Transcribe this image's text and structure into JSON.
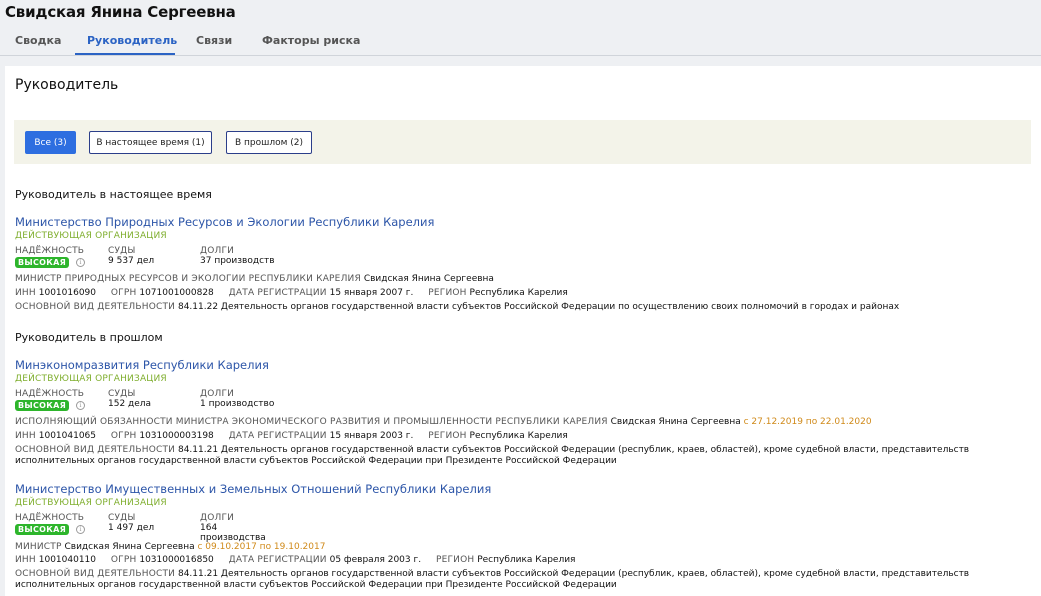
{
  "header": {
    "title": "Свидская Янина Сергеевна"
  },
  "tabs": [
    {
      "label": "Сводка"
    },
    {
      "label": "Руководитель"
    },
    {
      "label": "Связи"
    },
    {
      "label": "Факторы риска"
    }
  ],
  "section": {
    "title": "Руководитель"
  },
  "filters": [
    {
      "label": "Все (3)"
    },
    {
      "label": "В настоящее время (1)"
    },
    {
      "label": "В прошлом (2)"
    }
  ],
  "labels": {
    "reliability": "НАДЁЖНОСТЬ",
    "courts": "СУДЫ",
    "debts": "ДОЛГИ",
    "inn": "ИНН",
    "ogrn": "ОГРН",
    "reg_date": "ДАТА РЕГИСТРАЦИИ",
    "region": "РЕГИОН",
    "main_activity": "ОСНОВНОЙ ВИД ДЕЯТЕЛЬНОСТИ",
    "info_icon": "i"
  },
  "groups": {
    "current": "Руководитель в настоящее время",
    "past": "Руководитель в прошлом"
  },
  "orgs": [
    {
      "name": "Министерство Природных Ресурсов и Экологии Республики Карелия",
      "status": "ДЕЙСТВУЮЩАЯ ОРГАНИЗАЦИЯ",
      "reliability": "ВЫСОКАЯ",
      "courts": "9 537 дел",
      "debts": "37 производств",
      "position": "МИНИСТР ПРИРОДНЫХ РЕСУРСОВ И ЭКОЛОГИИ РЕСПУБЛИКИ КАРЕЛИЯ",
      "person": "Свидская Янина Сергеевна",
      "period": "",
      "inn": "1001016090",
      "ogrn": "1071001000828",
      "reg_date": "15 января 2007 г.",
      "region": "Республика Карелия",
      "activity": "84.11.22 Деятельность органов государственной власти субъектов Российской Федерации по осуществлению своих полномочий в городах и районах"
    },
    {
      "name": "Минэкономразвития Республики Карелия",
      "status": "ДЕЙСТВУЮЩАЯ ОРГАНИЗАЦИЯ",
      "reliability": "ВЫСОКАЯ",
      "courts": "152 дела",
      "debts": "1 производство",
      "position": "ИСПОЛНЯЮЩИЙ ОБЯЗАННОСТИ МИНИСТРА ЭКОНОМИЧЕСКОГО РАЗВИТИЯ И ПРОМЫШЛЕННОСТИ РЕСПУБЛИКИ КАРЕЛИЯ",
      "person": "Свидская Янина Сергеевна",
      "period": "с 27.12.2019 по 22.01.2020",
      "inn": "1001041065",
      "ogrn": "1031000003198",
      "reg_date": "15 января 2003 г.",
      "region": "Республика Карелия",
      "activity": "84.11.21 Деятельность органов государственной власти субъектов Российской Федерации (республик, краев, областей), кроме судебной власти, представительств исполнительных органов государственной власти субъектов Российской Федерации при Президенте Российской Федерации"
    },
    {
      "name": "Министерство Имущественных и Земельных Отношений Республики Карелия",
      "status": "ДЕЙСТВУЮЩАЯ ОРГАНИЗАЦИЯ",
      "reliability": "ВЫСОКАЯ",
      "courts": "1 497 дел",
      "debts_1": "164",
      "debts_2": "производства",
      "position": "МИНИСТР",
      "person": "Свидская Янина Сергеевна",
      "period": "с 09.10.2017 по 19.10.2017",
      "inn": "1001040110",
      "ogrn": "1031000016850",
      "reg_date": "05 февраля 2003 г.",
      "region": "Республика Карелия",
      "activity": "84.11.21 Деятельность органов государственной власти субъектов Российской Федерации (республик, краев, областей), кроме судебной власти, представительств исполнительных органов государственной власти субъектов Российской Федерации при Президенте Российской Федерации"
    }
  ]
}
